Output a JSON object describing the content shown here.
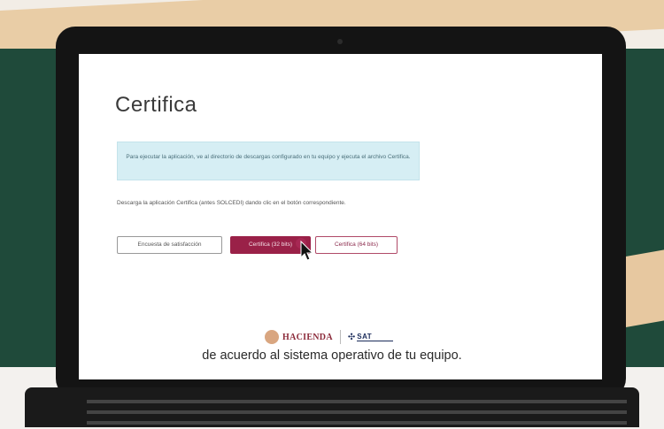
{
  "page": {
    "title": "Certifica",
    "info_text": "Para ejecutar la aplicación, ve al directorio de descargas configurado en tu equipo y ejecuta el archivo Certifica.",
    "description": "Descarga la aplicación Certifica (antes SOLCEDI) dando clic en el botón correspondiente.",
    "buttons": {
      "survey": "Encuesta de satisfacción",
      "download_32": "Certifica (32 bits)",
      "download_64": "Certifica (64 bits)"
    },
    "footer": {
      "hacienda": "HACIENDA",
      "sat": "SAT"
    }
  },
  "caption": "de acuerdo al sistema operativo de tu equipo.",
  "colors": {
    "primary": "#9a2148",
    "info_bg": "#d6eef4",
    "green_bg": "#1f4a3a",
    "sand": "#e9cda6"
  }
}
